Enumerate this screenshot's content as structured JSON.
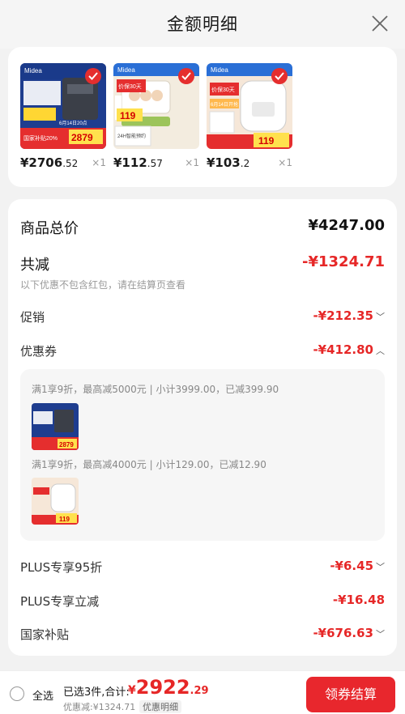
{
  "header": {
    "title": "金额明细"
  },
  "products": [
    {
      "price_int": "¥2706",
      "price_dec": ".52",
      "qty": "×1"
    },
    {
      "price_int": "¥112",
      "price_dec": ".57",
      "qty": "×1"
    },
    {
      "price_int": "¥103",
      "price_dec": ".2",
      "qty": "×1"
    }
  ],
  "product_thumbs": [
    {
      "brand": "Midea",
      "badge": "国家补贴20%",
      "price": "2879",
      "promo": "6月14日20点"
    },
    {
      "brand": "Midea",
      "badge": "价保30天",
      "price": "119",
      "promo": "24H智能预约"
    },
    {
      "brand": "Midea",
      "badge": "价保30天",
      "price": "119",
      "promo": "6月14日开抢"
    }
  ],
  "details": {
    "total_goods_label": "商品总价",
    "total_goods_value": "¥4247.00",
    "total_discount_label": "共减",
    "total_discount_value": "-¥1324.71",
    "note": "以下优惠不包含红包，请在结算页查看",
    "promo_label": "促销",
    "promo_value": "-¥212.35",
    "coupon_label": "优惠券",
    "coupon_value": "-¥412.80",
    "coupons": [
      {
        "desc": "满1享9折，最高减5000元 | 小计3999.00，已减399.90"
      },
      {
        "desc": "满1享9折，最高减4000元 | 小计129.00，已减12.90"
      }
    ],
    "plus95_label": "PLUS专享95折",
    "plus95_value": "-¥6.45",
    "plusdirect_label": "PLUS专享立减",
    "plusdirect_value": "-¥16.48",
    "subsidy_label": "国家补贴",
    "subsidy_value": "-¥676.63"
  },
  "bottom": {
    "select_all": "全选",
    "selected_info": "已选3件,合计:",
    "total_symbol": "¥",
    "total_int": "2922",
    "total_dec": ".29",
    "discount_line": "优惠减:¥1324.71",
    "detail_label": "优惠明细",
    "checkout_label": "领券结算"
  },
  "colors": {
    "accent": "#e62727",
    "button": "#e8272d"
  }
}
